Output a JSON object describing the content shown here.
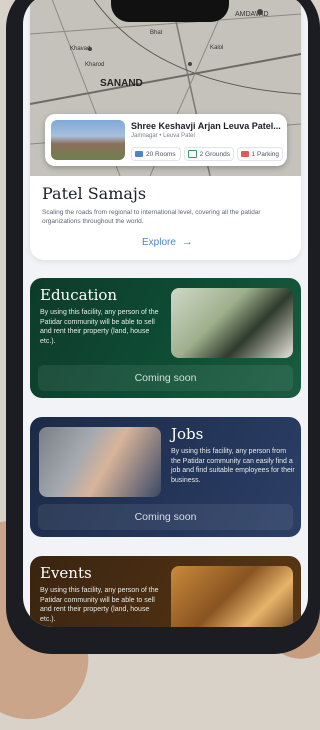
{
  "property": {
    "title": "Shree Keshavji Arjan Leuva Patel...",
    "subtitle": "Jamnagar • Leuva Patel",
    "rooms": "20 Rooms",
    "grounds": "2 Grounds",
    "parking": "1 Parking"
  },
  "map_labels": [
    "AMDAVAD",
    "SANAND",
    "Khavad",
    "Bhat",
    "Kharod",
    "Kalol"
  ],
  "patel_samaj": {
    "title": "Patel Samajs",
    "description": "Scaling the roads from regional to international level, covering all the patidar organizations throughout the world.",
    "explore_label": "Explore"
  },
  "education": {
    "title": "Education",
    "description": "By using this facility, any person of the Patidar community will be able to sell and rent their property (land, house etc.).",
    "status": "Coming soon"
  },
  "jobs": {
    "title": "Jobs",
    "description": "By using this facility, any person from the Patidar community can easily find a job and find suitable employees for their business.",
    "status": "Coming soon"
  },
  "events": {
    "title": "Events",
    "description": "By using this facility, any person of the Patidar community will be able to sell and rent their property (land, house etc.)."
  },
  "colors": {
    "accent": "#4a86c8",
    "education_bg": "#0f4f36",
    "jobs_bg": "#24365a",
    "events_bg": "#4e3013"
  }
}
